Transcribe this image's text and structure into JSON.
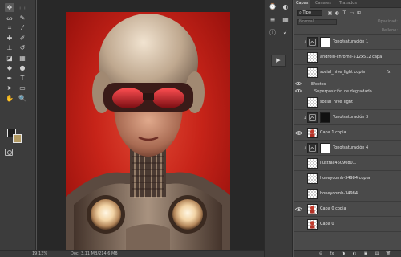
{
  "tools": {
    "items": [
      {
        "name": "move-tool",
        "glyph": "✥"
      },
      {
        "name": "marquee-tool",
        "glyph": "⬚"
      },
      {
        "name": "lasso-tool",
        "glyph": "ᔕ"
      },
      {
        "name": "quick-selection-tool",
        "glyph": "✎"
      },
      {
        "name": "crop-tool",
        "glyph": "⌗"
      },
      {
        "name": "eyedropper-tool",
        "glyph": "⁄"
      },
      {
        "name": "spot-healing-tool",
        "glyph": "✚"
      },
      {
        "name": "brush-tool",
        "glyph": "✐"
      },
      {
        "name": "clone-stamp-tool",
        "glyph": "⊥"
      },
      {
        "name": "history-brush-tool",
        "glyph": "↺"
      },
      {
        "name": "eraser-tool",
        "glyph": "◪"
      },
      {
        "name": "gradient-tool",
        "glyph": "▦"
      },
      {
        "name": "blur-tool",
        "glyph": "◆"
      },
      {
        "name": "dodge-tool",
        "glyph": "●"
      },
      {
        "name": "pen-tool",
        "glyph": "✒"
      },
      {
        "name": "type-tool",
        "glyph": "T"
      },
      {
        "name": "path-selection-tool",
        "glyph": "➤"
      },
      {
        "name": "rectangle-tool",
        "glyph": "▭"
      },
      {
        "name": "hand-tool",
        "glyph": "✋"
      },
      {
        "name": "zoom-tool",
        "glyph": "🔍"
      },
      {
        "name": "more-tools",
        "glyph": "⋯"
      }
    ],
    "foreground_color": "#1f1f1f",
    "background_color": "#b29a63"
  },
  "status": {
    "zoom": "19,13%",
    "doc": "Doc: 3,11 MB/214,6 MB",
    "arrow": "›"
  },
  "panel": {
    "tabs": [
      "Capas",
      "Canales",
      "Trazados"
    ],
    "filter_kind": "Tipo",
    "blend_mode": "Normal",
    "opacity_label": "Opacidad:",
    "fill_label": "Relleno:",
    "footer": [
      "⊖",
      "fx",
      "◑",
      "◐",
      "▣",
      "▤",
      "🗑"
    ]
  },
  "layers": [
    {
      "name": "Tono/saturación 1",
      "type": "adjustment",
      "visible": false,
      "clipped": true
    },
    {
      "name": "android-chrome-512x512 capa",
      "type": "pixel",
      "visible": false,
      "clipped": false
    },
    {
      "name": "social_hive_light copia",
      "type": "pixel",
      "visible": false,
      "clipped": false,
      "fx": "fx"
    },
    {
      "name": "Efectos",
      "type": "effect-group"
    },
    {
      "name": "Superposición de degradado",
      "type": "effect"
    },
    {
      "name": "social_hive_light",
      "type": "pixel",
      "visible": false,
      "clipped": false
    },
    {
      "name": "Tono/saturación 3",
      "type": "adjustment",
      "visible": false,
      "clipped": true
    },
    {
      "name": "Capa 1 copia",
      "type": "pixel",
      "visible": true,
      "clipped": false
    },
    {
      "name": "Tono/saturación 4",
      "type": "adjustment",
      "visible": false,
      "clipped": true
    },
    {
      "name": "Ilustrac4609080...",
      "type": "pixel",
      "visible": false,
      "clipped": false
    },
    {
      "name": "honeycomb-34984 copia",
      "type": "pixel",
      "visible": false,
      "clipped": false
    },
    {
      "name": "honeycomb-34984",
      "type": "pixel",
      "visible": false,
      "clipped": false
    },
    {
      "name": "Capa 0 copia",
      "type": "pixel",
      "visible": true,
      "clipped": false
    },
    {
      "name": "Capa 0",
      "type": "pixel",
      "visible": false,
      "clipped": false
    }
  ]
}
